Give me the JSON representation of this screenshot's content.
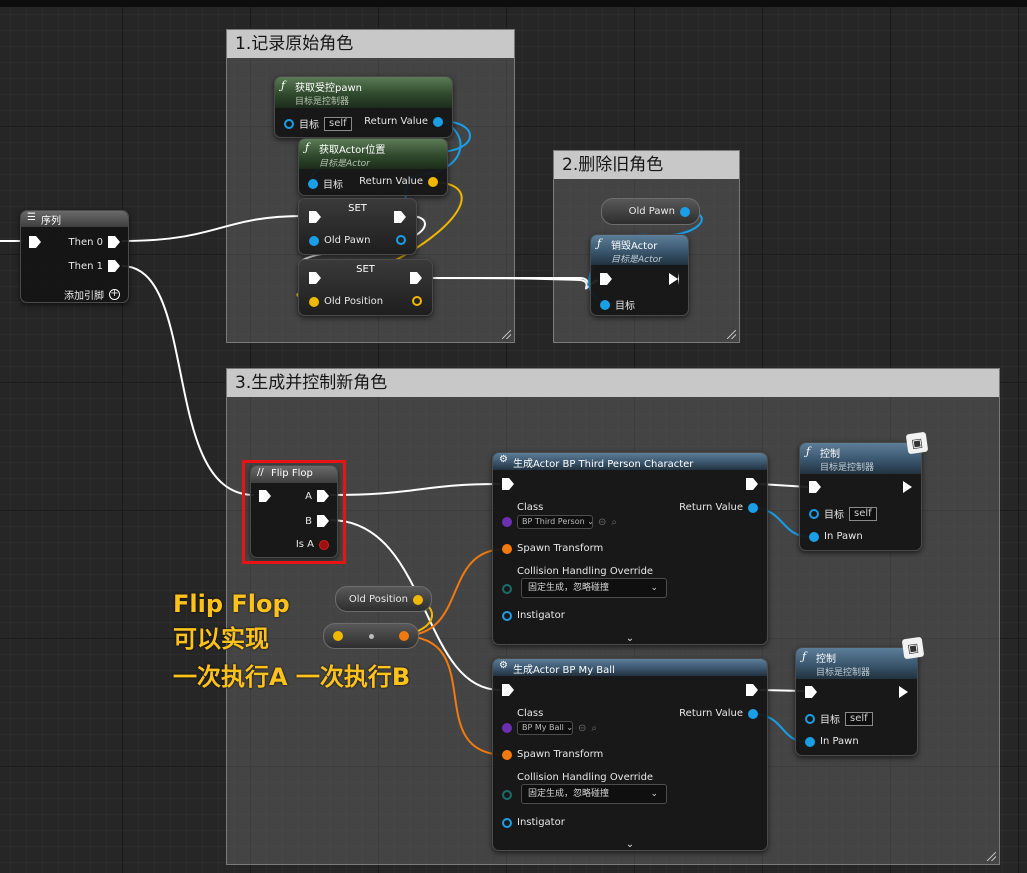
{
  "comments": {
    "c1": "1.记录原始角色",
    "c2": "2.删除旧角色",
    "c3": "3.生成并控制新角色"
  },
  "sequence": {
    "title": "序列",
    "then0": "Then 0",
    "then1": "Then 1",
    "add_pin": "添加引脚"
  },
  "get_pawn": {
    "title": "获取受控pawn",
    "subtitle": "目标是控制器",
    "target_label": "目标",
    "target_value": "self",
    "return_label": "Return Value"
  },
  "get_actor_location": {
    "title": "获取Actor位置",
    "subtitle": "目标是Actor",
    "target_label": "目标",
    "return_label": "Return Value"
  },
  "set_old_pawn": {
    "title": "SET",
    "var": "Old Pawn"
  },
  "set_old_position": {
    "title": "SET",
    "var": "Old Position"
  },
  "get_old_pawn": {
    "label": "Old Pawn"
  },
  "destroy_actor": {
    "title": "销毁Actor",
    "subtitle": "目标是Actor",
    "target_label": "目标"
  },
  "flip_flop": {
    "title": "Flip Flop",
    "a": "A",
    "b": "B",
    "is_a": "Is A"
  },
  "get_old_position": {
    "label": "Old Position"
  },
  "spawn_tpc": {
    "title": "生成Actor BP Third Person Character",
    "class_label": "Class",
    "class_value": "BP Third Person",
    "return_label": "Return Value",
    "spawn_transform": "Spawn Transform",
    "collision_label": "Collision Handling Override",
    "collision_value": "固定生成，忽略碰撞",
    "instigator": "Instigator"
  },
  "spawn_ball": {
    "title": "生成Actor BP My Ball",
    "class_label": "Class",
    "class_value": "BP My Ball",
    "return_label": "Return Value",
    "spawn_transform": "Spawn Transform",
    "collision_label": "Collision Handling Override",
    "collision_value": "固定生成，忽略碰撞",
    "instigator": "Instigator"
  },
  "possess_1": {
    "title": "控制",
    "subtitle": "目标是控制器",
    "target_label": "目标",
    "target_value": "self",
    "in_pawn": "In Pawn"
  },
  "possess_2": {
    "title": "控制",
    "subtitle": "目标是控制器",
    "target_label": "目标",
    "target_value": "self",
    "in_pawn": "In Pawn"
  },
  "annotation": {
    "line1": "Flip Flop",
    "line2": "可以实现",
    "line3": "一次执行A 一次执行B"
  },
  "colors": {
    "exec": "#ffffff",
    "object_pin": "#1a9ee6",
    "vector_pin": "#f0b800",
    "transform_pin": "#f07a10",
    "class_pin": "#6b2fb0",
    "bool_pin": "#9e1010",
    "highlight": "#e81414",
    "annotation_text": "#ffc21a"
  }
}
